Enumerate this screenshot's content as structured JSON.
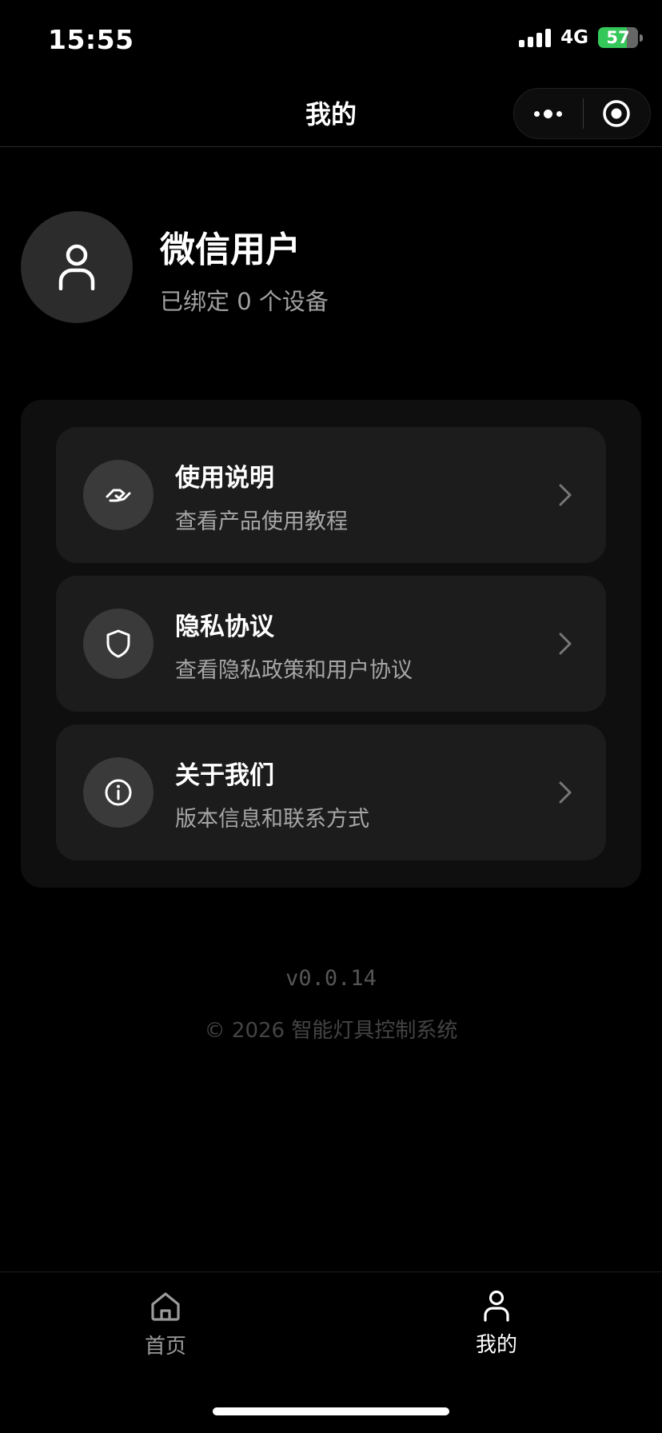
{
  "status_bar": {
    "time": "15:55",
    "network": "4G",
    "battery": "57"
  },
  "nav": {
    "title": "我的"
  },
  "profile": {
    "name": "微信用户",
    "device_count": "已绑定 0 个设备"
  },
  "menu": {
    "items": [
      {
        "title": "使用说明",
        "subtitle": "查看产品使用教程",
        "icon": "handshake-icon"
      },
      {
        "title": "隐私协议",
        "subtitle": "查看隐私政策和用户协议",
        "icon": "shield-icon"
      },
      {
        "title": "关于我们",
        "subtitle": "版本信息和联系方式",
        "icon": "info-icon"
      }
    ]
  },
  "footer": {
    "version": "v0.0.14",
    "copyright": "© 2026 智能灯具控制系统"
  },
  "tab_bar": {
    "tabs": [
      {
        "label": "首页",
        "icon": "home-icon",
        "active": false
      },
      {
        "label": "我的",
        "icon": "user-icon",
        "active": true
      }
    ]
  },
  "colors": {
    "background": "#000000",
    "panel": "#0f0f0f",
    "card": "#1c1c1c",
    "battery": "#34c759"
  }
}
